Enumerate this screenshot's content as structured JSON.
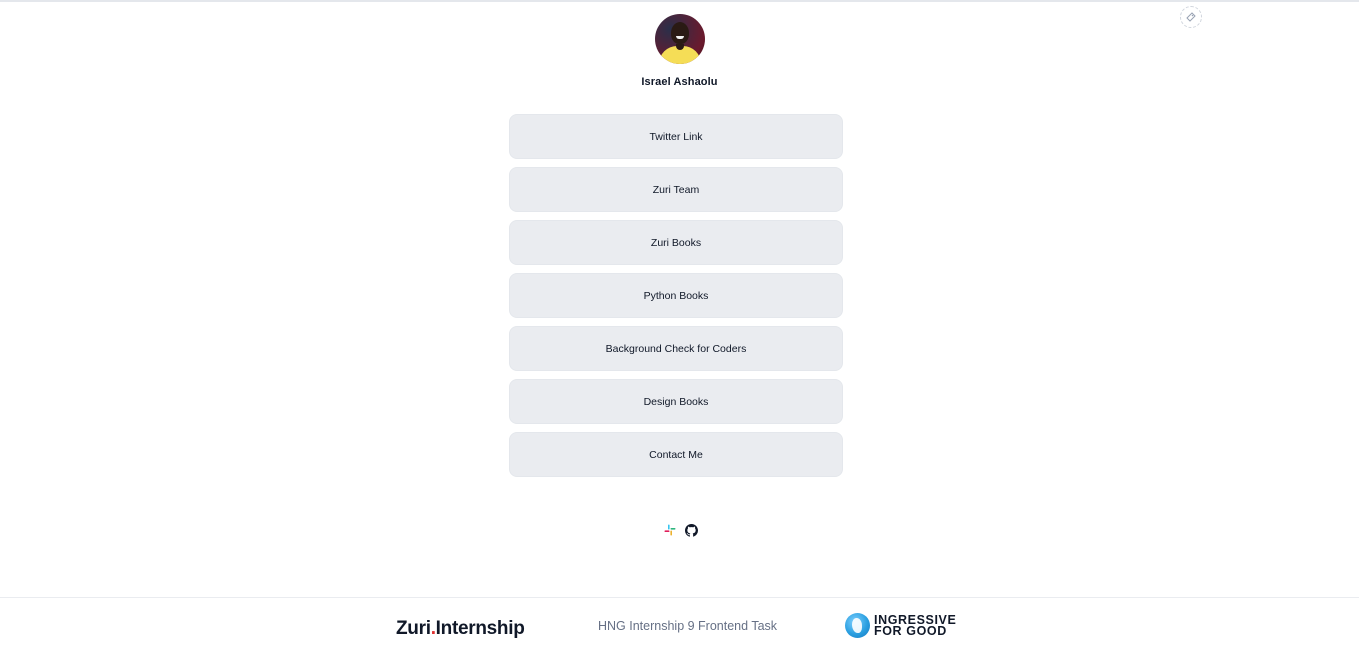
{
  "profile": {
    "name": "Israel Ashaolu"
  },
  "links": [
    {
      "label": "Twitter Link"
    },
    {
      "label": "Zuri Team"
    },
    {
      "label": "Zuri Books"
    },
    {
      "label": "Python Books"
    },
    {
      "label": "Background Check for Coders"
    },
    {
      "label": "Design Books"
    },
    {
      "label": "Contact Me"
    }
  ],
  "socials": [
    {
      "icon": "slack-icon"
    },
    {
      "icon": "github-icon"
    }
  ],
  "footer": {
    "logo_main": "Zuri",
    "logo_dot": ".",
    "logo_suffix": "Internship",
    "text": "HNG Internship 9 Frontend Task",
    "partner_line1": "INGRESSIVE",
    "partner_line2": "FOR GOOD"
  },
  "colors": {
    "button_bg": "#eaecf0",
    "accent_red": "#e02e2e",
    "footer_text": "#667085"
  }
}
